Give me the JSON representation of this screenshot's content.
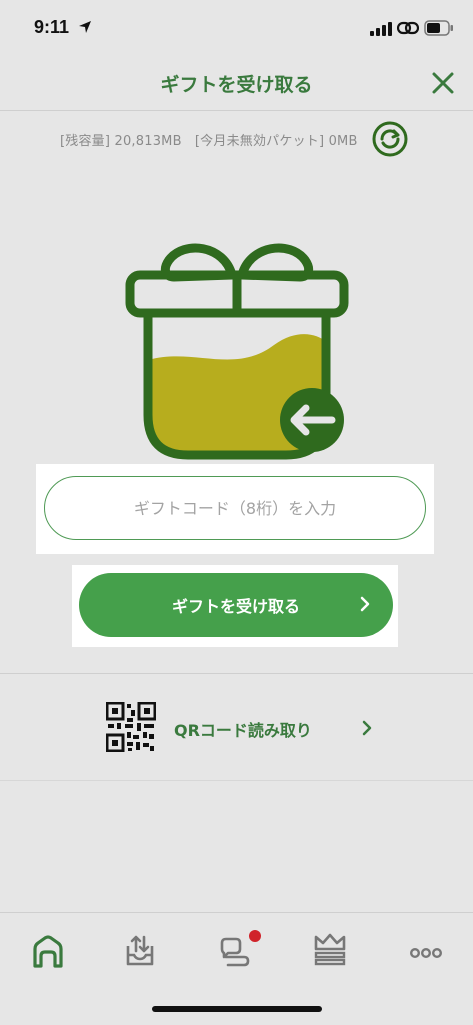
{
  "status_bar": {
    "time": "9:11"
  },
  "header": {
    "title": "ギフトを受け取る"
  },
  "capacity": {
    "text": "[残容量] 20,813MB　[今月未無効パケット] 0MB"
  },
  "gift_code_input": {
    "value": "",
    "placeholder": "ギフトコード（8桁）を入力"
  },
  "receive_button": {
    "label": "ギフトを受け取る"
  },
  "qr_row": {
    "label": "QRコード読み取り"
  },
  "tabbar": {
    "items": [
      {
        "icon": "home-icon"
      },
      {
        "icon": "upload-tray-icon"
      },
      {
        "icon": "chat-bubble-icon",
        "badge": true
      },
      {
        "icon": "crown-icon"
      },
      {
        "icon": "more-icon"
      }
    ]
  },
  "colors": {
    "accent": "#45a04b",
    "title_green": "#3a7a3e",
    "gift_green": "#2f6a1e",
    "gift_fill": "#b7ad1e",
    "badge_red": "#d0232a"
  }
}
